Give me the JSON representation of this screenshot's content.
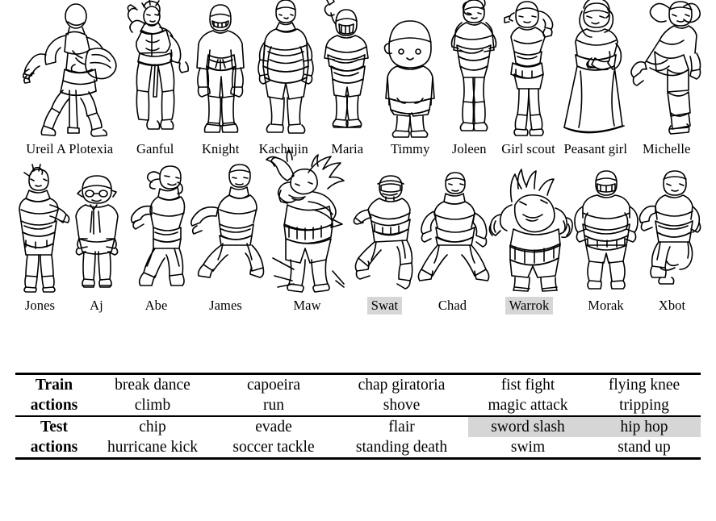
{
  "characters": {
    "row1": [
      {
        "name": "Ureil A Plotexia",
        "highlight": false,
        "art": "ureil-a-plotexia"
      },
      {
        "name": "Ganful",
        "highlight": false,
        "art": "ganful"
      },
      {
        "name": "Knight",
        "highlight": false,
        "art": "knight"
      },
      {
        "name": "Kachujin",
        "highlight": false,
        "art": "kachujin"
      },
      {
        "name": "Maria",
        "highlight": false,
        "art": "maria"
      },
      {
        "name": "Timmy",
        "highlight": false,
        "art": "timmy"
      },
      {
        "name": "Joleen",
        "highlight": false,
        "art": "joleen"
      },
      {
        "name": "Girl scout",
        "highlight": false,
        "art": "girl-scout"
      },
      {
        "name": "Peasant girl",
        "highlight": false,
        "art": "peasant-girl"
      },
      {
        "name": "Michelle",
        "highlight": false,
        "art": "michelle"
      }
    ],
    "row2": [
      {
        "name": "Jones",
        "highlight": false,
        "art": "jones"
      },
      {
        "name": "Aj",
        "highlight": false,
        "art": "aj"
      },
      {
        "name": "Abe",
        "highlight": false,
        "art": "abe"
      },
      {
        "name": "James",
        "highlight": false,
        "art": "james"
      },
      {
        "name": "Maw",
        "highlight": false,
        "art": "maw"
      },
      {
        "name": "Swat",
        "highlight": true,
        "art": "swat"
      },
      {
        "name": "Chad",
        "highlight": false,
        "art": "chad"
      },
      {
        "name": "Warrok",
        "highlight": true,
        "art": "warrok"
      },
      {
        "name": "Morak",
        "highlight": false,
        "art": "morak"
      },
      {
        "name": "Xbot",
        "highlight": false,
        "art": "xbot"
      }
    ]
  },
  "table": {
    "train": {
      "head_line1": "Train",
      "head_line2": "actions",
      "row_top": [
        "break dance",
        "capoeira",
        "chap giratoria",
        "fist fight",
        "flying knee"
      ],
      "row_bottom": [
        "climb",
        "run",
        "shove",
        "magic attack",
        "tripping"
      ],
      "highlight_top": [
        false,
        false,
        false,
        false,
        false
      ],
      "highlight_bottom": [
        false,
        false,
        false,
        false,
        false
      ]
    },
    "test": {
      "head_line1": "Test",
      "head_line2": "actions",
      "row_top": [
        "chip",
        "evade",
        "flair",
        "sword slash",
        "hip hop"
      ],
      "row_bottom": [
        "hurricane kick",
        "soccer tackle",
        "standing death",
        "swim",
        "stand up"
      ],
      "highlight_top": [
        false,
        false,
        false,
        true,
        true
      ],
      "highlight_bottom": [
        false,
        false,
        false,
        false,
        false
      ]
    }
  },
  "colors": {
    "highlight": "#d6d6d6",
    "ink": "#000000",
    "background": "#ffffff"
  }
}
